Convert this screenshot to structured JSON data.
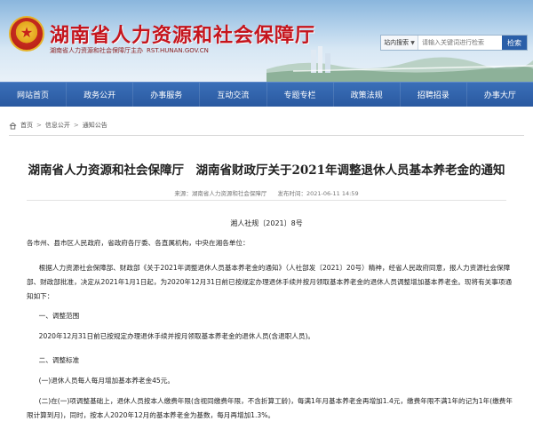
{
  "header": {
    "site_title": "湖南省人力资源和社会保障厅",
    "subtitle": "湖南省人力资源和社会保障厅主办",
    "url": "RST.HUNAN.GOV.CN",
    "search": {
      "scope_label": "站内搜索",
      "placeholder": "请输入关键词进行检索",
      "button_label": "检索"
    }
  },
  "nav": {
    "items": [
      "网站首页",
      "政务公开",
      "办事服务",
      "互动交流",
      "专题专栏",
      "政策法规",
      "招聘招录",
      "办事大厅"
    ]
  },
  "breadcrumb": {
    "items": [
      "首页",
      "信息公开",
      "通知公告"
    ]
  },
  "article": {
    "title": "湖南省人力资源和社会保障厅　湖南省财政厅关于2021年调整退休人员基本养老金的通知",
    "source": "来源：湖南省人力资源和社会保障厅",
    "published": "发布时间：2021-06-11 14:59",
    "doc_number": "湘人社规〔2021〕8号",
    "salutation": "各市州、县市区人民政府，省政府各厅委、各直属机构，中央在湘各单位：",
    "intro": "根据人力资源社会保障部、财政部《关于2021年调整退休人员基本养老金的通知》（人社部发〔2021〕20号）精神，经省人民政府同意，报人力资源社会保障部、财政部批准，决定从2021年1月1日起，为2020年12月31日前已按规定办理退休手续并按月领取基本养老金的退休人员调整增加基本养老金。现将有关事项通知如下：",
    "section1_heading": "一、调整范围",
    "section1_body": "2020年12月31日前已按规定办理退休手续并按月领取基本养老金的退休人员(含退职人员)。",
    "section2_heading": "二、调整标准",
    "item1": "(一)退休人员每人每月增加基本养老金45元。",
    "item2": "(二)在(一)项调整基础上，退休人员按本人缴费年限(含视同缴费年限，不含折算工龄)，每满1年月基本养老金再增加1.4元，缴费年限不满1年的记为1年(缴费年限计算到月)，同时，按本人2020年12月的基本养老金为基数，每月再增加1.3%。"
  },
  "colors": {
    "brand_red": "#c5151d",
    "nav_blue": "#2a59a0"
  }
}
